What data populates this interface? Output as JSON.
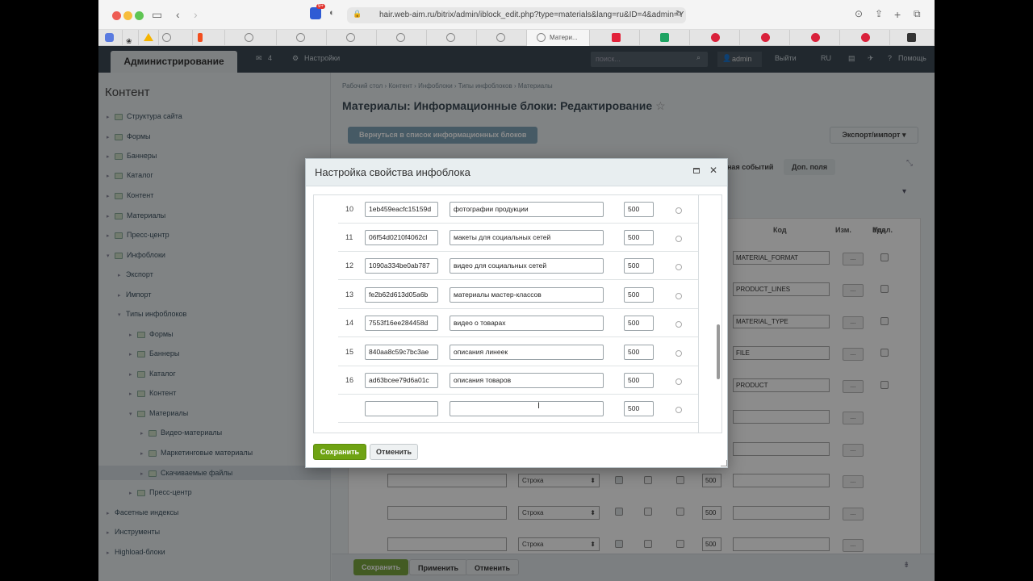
{
  "browser": {
    "url": "hair.web-aim.ru/bitrix/admin/iblock_edit.php?type=materials&lang=ru&ID=4&admin=Y",
    "badge": "9+",
    "active_tab_label": "Матери..."
  },
  "admin": {
    "tab_title": "Администрирование",
    "notif_count": "4",
    "settings_label": "Настройки",
    "search_placeholder": "поиск...",
    "user": "admin",
    "logout": "Выйти",
    "lang": "RU",
    "help": "Помощь"
  },
  "sidebar": {
    "title": "Контент",
    "items": [
      {
        "label": "Структура сайта"
      },
      {
        "label": "Формы"
      },
      {
        "label": "Баннеры"
      },
      {
        "label": "Каталог"
      },
      {
        "label": "Контент"
      },
      {
        "label": "Материалы"
      },
      {
        "label": "Пресс-центр"
      },
      {
        "label": "Инфоблоки"
      },
      {
        "label": "Экспорт"
      },
      {
        "label": "Импорт"
      },
      {
        "label": "Типы инфоблоков"
      },
      {
        "label": "Формы"
      },
      {
        "label": "Баннеры"
      },
      {
        "label": "Каталог"
      },
      {
        "label": "Контент"
      },
      {
        "label": "Материалы"
      },
      {
        "label": "Видео-материалы"
      },
      {
        "label": "Маркетинговые материалы"
      },
      {
        "label": "Скачиваемые файлы"
      },
      {
        "label": "Пресс-центр"
      },
      {
        "label": "Фасетные индексы"
      },
      {
        "label": "Инструменты"
      },
      {
        "label": "Highload-блоки"
      }
    ]
  },
  "page": {
    "breadcrumbs": "Рабочий стол  ›  Контент  ›  Инфоблоки  ›  Типы инфоблоков  ›  Материалы",
    "title": "Материалы: Информационные блоки: Редактирование",
    "back_button": "Вернуться в список информационных блоков",
    "export_button": "Экспорт/импорт",
    "tab_events": "ная событий",
    "tab_fields": "Доп. поля",
    "col_code": "Код",
    "col_edit": "Изм.",
    "col_delete": "Удал.",
    "codes": [
      "MATERIAL_FORMAT",
      "PRODUCT_LINES",
      "MATERIAL_TYPE",
      "FILE",
      "PRODUCT"
    ],
    "select_type": "Строка",
    "sort_value": "500",
    "edit_btn": "...",
    "footer_save": "Сохранить",
    "footer_apply": "Применить",
    "footer_cancel": "Отменить"
  },
  "dialog": {
    "title": "Настройка свойства инфоблока",
    "rows": [
      {
        "num": "10",
        "xml_id": "1eb459eacfc15159d",
        "value": "фотографии продукции",
        "sort": "500"
      },
      {
        "num": "11",
        "xml_id": "06f54d0210f4062cl",
        "value": "макеты для социальных сетей",
        "sort": "500"
      },
      {
        "num": "12",
        "xml_id": "1090a334be0ab787",
        "value": "видео для социальных сетей",
        "sort": "500"
      },
      {
        "num": "13",
        "xml_id": "fe2b62d613d05a6b",
        "value": "материалы мастер-классов",
        "sort": "500"
      },
      {
        "num": "14",
        "xml_id": "7553f16ee284458d",
        "value": "видео о товарах",
        "sort": "500"
      },
      {
        "num": "15",
        "xml_id": "840aa8c59c7bc3ae",
        "value": "описания линеек",
        "sort": "500"
      },
      {
        "num": "16",
        "xml_id": "ad63bcee79d6a01c",
        "value": "описания товаров",
        "sort": "500"
      },
      {
        "num": "",
        "xml_id": "",
        "value": "",
        "sort": "500"
      }
    ],
    "save": "Сохранить",
    "cancel": "Отменить"
  }
}
